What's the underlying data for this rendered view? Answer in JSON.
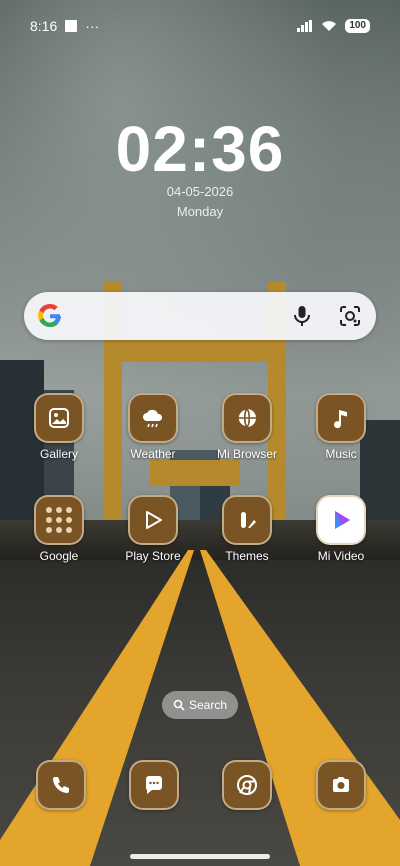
{
  "status_bar": {
    "time": "8:16",
    "more": "···",
    "battery": "100"
  },
  "clock": {
    "time": "02:36",
    "date": "04-05-2026",
    "day": "Monday"
  },
  "search_widget": {
    "brand": "Google",
    "icons": [
      "google-g-icon",
      "microphone-icon",
      "google-lens-icon"
    ]
  },
  "apps_row1": [
    {
      "label": "Gallery",
      "icon": "gallery-icon"
    },
    {
      "label": "Weather",
      "icon": "weather-icon"
    },
    {
      "label": "Mi Browser",
      "icon": "browser-icon"
    },
    {
      "label": "Music",
      "icon": "music-icon"
    }
  ],
  "apps_row2": [
    {
      "label": "Google",
      "icon": "google-folder-icon"
    },
    {
      "label": "Play Store",
      "icon": "play-store-icon"
    },
    {
      "label": "Themes",
      "icon": "themes-icon"
    },
    {
      "label": "Mi Video",
      "icon": "mi-video-icon"
    }
  ],
  "app_search": {
    "label": "Search",
    "icon": "search-icon"
  },
  "dock": [
    "phone-icon",
    "messages-icon",
    "chrome-icon",
    "camera-icon"
  ],
  "colors": {
    "icon_bg": "#7a5424",
    "icon_border": "#dcc8aa",
    "road_line": "#e3a52b"
  }
}
